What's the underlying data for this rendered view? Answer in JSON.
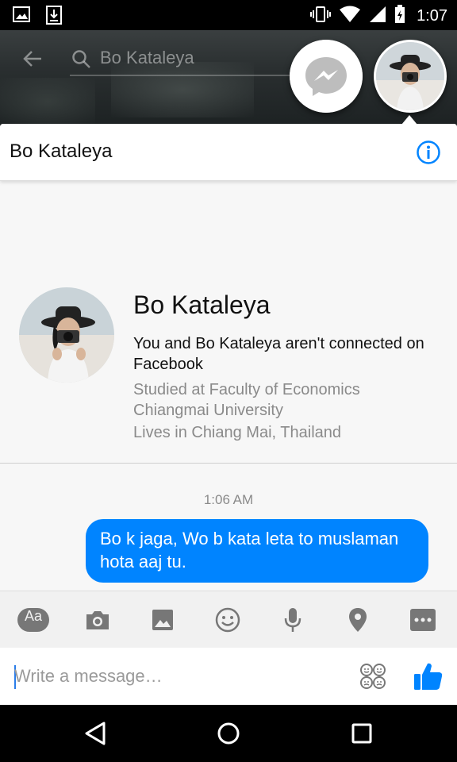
{
  "status_bar": {
    "time": "1:07",
    "left_icons": [
      "image-notification-icon",
      "download-notification-icon"
    ],
    "right_icons": [
      "vibrate-icon",
      "wifi-icon",
      "cell-signal-icon",
      "battery-icon"
    ]
  },
  "background_app": {
    "search_text": "Bo Kataleya"
  },
  "chathead": {
    "title": "Bo Kataleya"
  },
  "profile": {
    "name": "Bo Kataleya",
    "connection": "You and Bo Kataleya aren't connected on Facebook",
    "studied": "Studied at Faculty of Economics Chiangmai University",
    "lives": "Lives in Chiang Mai, Thailand"
  },
  "conversation": {
    "timestamp": "1:06 AM",
    "messages": [
      {
        "sender": "me",
        "text": "Bo k jaga, Wo b kata leta to muslaman hota aaj tu."
      }
    ]
  },
  "composer": {
    "text_button_label": "Aa",
    "placeholder": "Write a message…",
    "toolbar_icons": [
      "text-icon",
      "camera-icon",
      "gallery-icon",
      "emoji-icon",
      "microphone-icon",
      "location-icon",
      "more-icon"
    ]
  },
  "colors": {
    "accent": "#0084ff",
    "card_bg": "#f7f7f7",
    "muted_text": "#8a8a8a",
    "toolbar_icon": "#777777"
  }
}
